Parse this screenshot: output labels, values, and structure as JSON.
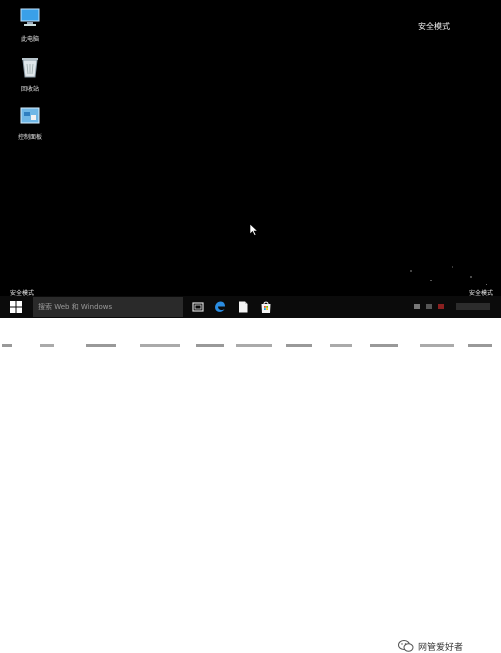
{
  "desktop": {
    "icons": [
      {
        "label": "此电脑",
        "icon": "computer-icon"
      },
      {
        "label": "回收站",
        "icon": "recycle-bin-icon"
      },
      {
        "label": "控制面板",
        "icon": "control-panel-icon"
      }
    ],
    "safe_mode_top": "安全模式",
    "safe_mode_bottom_left": "安全模式",
    "safe_mode_bottom_right": "安全模式"
  },
  "taskbar": {
    "search_placeholder": "搜索 Web 和 Windows",
    "buttons": [
      "task-view-icon",
      "edge-icon",
      "file-icon",
      "store-icon"
    ]
  },
  "watermark": {
    "text": "网管爱好者"
  },
  "colors": {
    "desktop": "#000000",
    "taskbar": "#0b0b0b",
    "search_box": "#2a2a2a",
    "accent": "#1e90ff"
  }
}
